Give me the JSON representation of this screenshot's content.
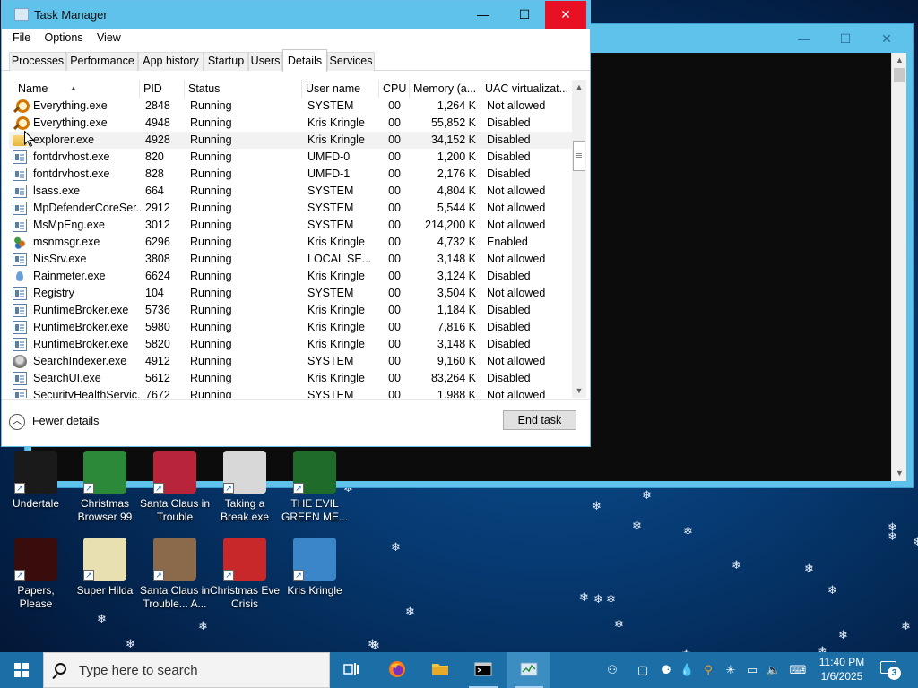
{
  "task_manager": {
    "title": "Task Manager",
    "menu": [
      "File",
      "Options",
      "View"
    ],
    "tabs": [
      "Processes",
      "Performance",
      "App history",
      "Startup",
      "Users",
      "Details",
      "Services"
    ],
    "active_tab": "Details",
    "columns": [
      "Name",
      "PID",
      "Status",
      "User name",
      "CPU",
      "Memory (a...",
      "UAC virtualizat..."
    ],
    "sort_column": "Name",
    "rows": [
      {
        "icon": "magnifier-icon",
        "name": "Everything.exe",
        "pid": "2848",
        "status": "Running",
        "user": "SYSTEM",
        "cpu": "00",
        "memory": "1,264 K",
        "uac": "Not allowed"
      },
      {
        "icon": "magnifier-icon",
        "name": "Everything.exe",
        "pid": "4948",
        "status": "Running",
        "user": "Kris Kringle",
        "cpu": "00",
        "memory": "55,852 K",
        "uac": "Disabled"
      },
      {
        "icon": "folder-icon",
        "name": "explorer.exe",
        "pid": "4928",
        "status": "Running",
        "user": "Kris Kringle",
        "cpu": "00",
        "memory": "34,152 K",
        "uac": "Disabled"
      },
      {
        "icon": "app-window-icon",
        "name": "fontdrvhost.exe",
        "pid": "820",
        "status": "Running",
        "user": "UMFD-0",
        "cpu": "00",
        "memory": "1,200 K",
        "uac": "Disabled"
      },
      {
        "icon": "app-window-icon",
        "name": "fontdrvhost.exe",
        "pid": "828",
        "status": "Running",
        "user": "UMFD-1",
        "cpu": "00",
        "memory": "2,176 K",
        "uac": "Disabled"
      },
      {
        "icon": "app-window-icon",
        "name": "lsass.exe",
        "pid": "664",
        "status": "Running",
        "user": "SYSTEM",
        "cpu": "00",
        "memory": "4,804 K",
        "uac": "Not allowed"
      },
      {
        "icon": "app-window-icon",
        "name": "MpDefenderCoreSer...",
        "pid": "2912",
        "status": "Running",
        "user": "SYSTEM",
        "cpu": "00",
        "memory": "5,544 K",
        "uac": "Not allowed"
      },
      {
        "icon": "app-window-icon",
        "name": "MsMpEng.exe",
        "pid": "3012",
        "status": "Running",
        "user": "SYSTEM",
        "cpu": "00",
        "memory": "214,200 K",
        "uac": "Not allowed"
      },
      {
        "icon": "people-icon",
        "name": "msnmsgr.exe",
        "pid": "6296",
        "status": "Running",
        "user": "Kris Kringle",
        "cpu": "00",
        "memory": "4,732 K",
        "uac": "Enabled"
      },
      {
        "icon": "app-window-icon",
        "name": "NisSrv.exe",
        "pid": "3808",
        "status": "Running",
        "user": "LOCAL SE...",
        "cpu": "00",
        "memory": "3,148 K",
        "uac": "Not allowed"
      },
      {
        "icon": "drop-icon",
        "name": "Rainmeter.exe",
        "pid": "6624",
        "status": "Running",
        "user": "Kris Kringle",
        "cpu": "00",
        "memory": "3,124 K",
        "uac": "Disabled"
      },
      {
        "icon": "app-window-icon",
        "name": "Registry",
        "pid": "104",
        "status": "Running",
        "user": "SYSTEM",
        "cpu": "00",
        "memory": "3,504 K",
        "uac": "Not allowed"
      },
      {
        "icon": "app-window-icon",
        "name": "RuntimeBroker.exe",
        "pid": "5736",
        "status": "Running",
        "user": "Kris Kringle",
        "cpu": "00",
        "memory": "1,184 K",
        "uac": "Disabled"
      },
      {
        "icon": "app-window-icon",
        "name": "RuntimeBroker.exe",
        "pid": "5980",
        "status": "Running",
        "user": "Kris Kringle",
        "cpu": "00",
        "memory": "7,816 K",
        "uac": "Disabled"
      },
      {
        "icon": "app-window-icon",
        "name": "RuntimeBroker.exe",
        "pid": "5820",
        "status": "Running",
        "user": "Kris Kringle",
        "cpu": "00",
        "memory": "3,148 K",
        "uac": "Disabled"
      },
      {
        "icon": "search-indexer-icon",
        "name": "SearchIndexer.exe",
        "pid": "4912",
        "status": "Running",
        "user": "SYSTEM",
        "cpu": "00",
        "memory": "9,160 K",
        "uac": "Not allowed"
      },
      {
        "icon": "app-window-icon",
        "name": "SearchUI.exe",
        "pid": "5612",
        "status": "Running",
        "user": "Kris Kringle",
        "cpu": "00",
        "memory": "83,264 K",
        "uac": "Disabled"
      },
      {
        "icon": "app-window-icon",
        "name": "SecurityHealthServic...",
        "pid": "7672",
        "status": "Running",
        "user": "SYSTEM",
        "cpu": "00",
        "memory": "1,988 K",
        "uac": "Not allowed"
      }
    ],
    "fewer_details": "Fewer details",
    "end_task": "End task"
  },
  "desktop_icons": [
    {
      "label": "Undertale",
      "color": "#1a1a1a"
    },
    {
      "label": "Christmas Browser 99",
      "color": "#2a8a3a"
    },
    {
      "label": "Santa Claus in Trouble",
      "color": "#b8243a"
    },
    {
      "label": "Taking a Break.exe",
      "color": "#d8d8d8"
    },
    {
      "label": "THE EVIL GREEN ME...",
      "color": "#1f6b2a"
    },
    {
      "label": "Papers, Please",
      "color": "#3a0d0d"
    },
    {
      "label": "Super Hilda",
      "color": "#e8e0b0"
    },
    {
      "label": "Santa Claus in Trouble... A...",
      "color": "#8a6a4a"
    },
    {
      "label": "Christmas Eve Crisis",
      "color": "#c8282a"
    },
    {
      "label": "Kris Kringle",
      "color": "#3a86c8"
    }
  ],
  "taskbar": {
    "search_placeholder": "Type here to search",
    "time": "11:40 PM",
    "date": "1/6/2025",
    "notification_count": "3"
  }
}
